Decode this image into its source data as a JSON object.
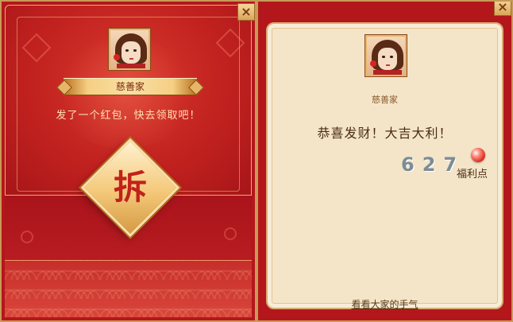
{
  "left_panel": {
    "sender_name": "慈善家",
    "message": "发了一个红包，快去领取吧！",
    "open_button_label": "拆",
    "close_label": "×"
  },
  "right_panel": {
    "sender_name": "慈善家",
    "congrats": "恭喜发财！大吉大利！",
    "amount": "627",
    "points_label": "福利点",
    "luck_link": "看看大家的手气",
    "close_label": "×"
  },
  "colors": {
    "envelope_red": "#b5161c",
    "gold_trim": "#e7b567",
    "paper": "#f4e5c9",
    "amount_gray": "#7d8c96"
  },
  "icons": {
    "open_seal": "diamond-seal-icon",
    "points": "red-orb-icon",
    "close": "close-icon"
  }
}
